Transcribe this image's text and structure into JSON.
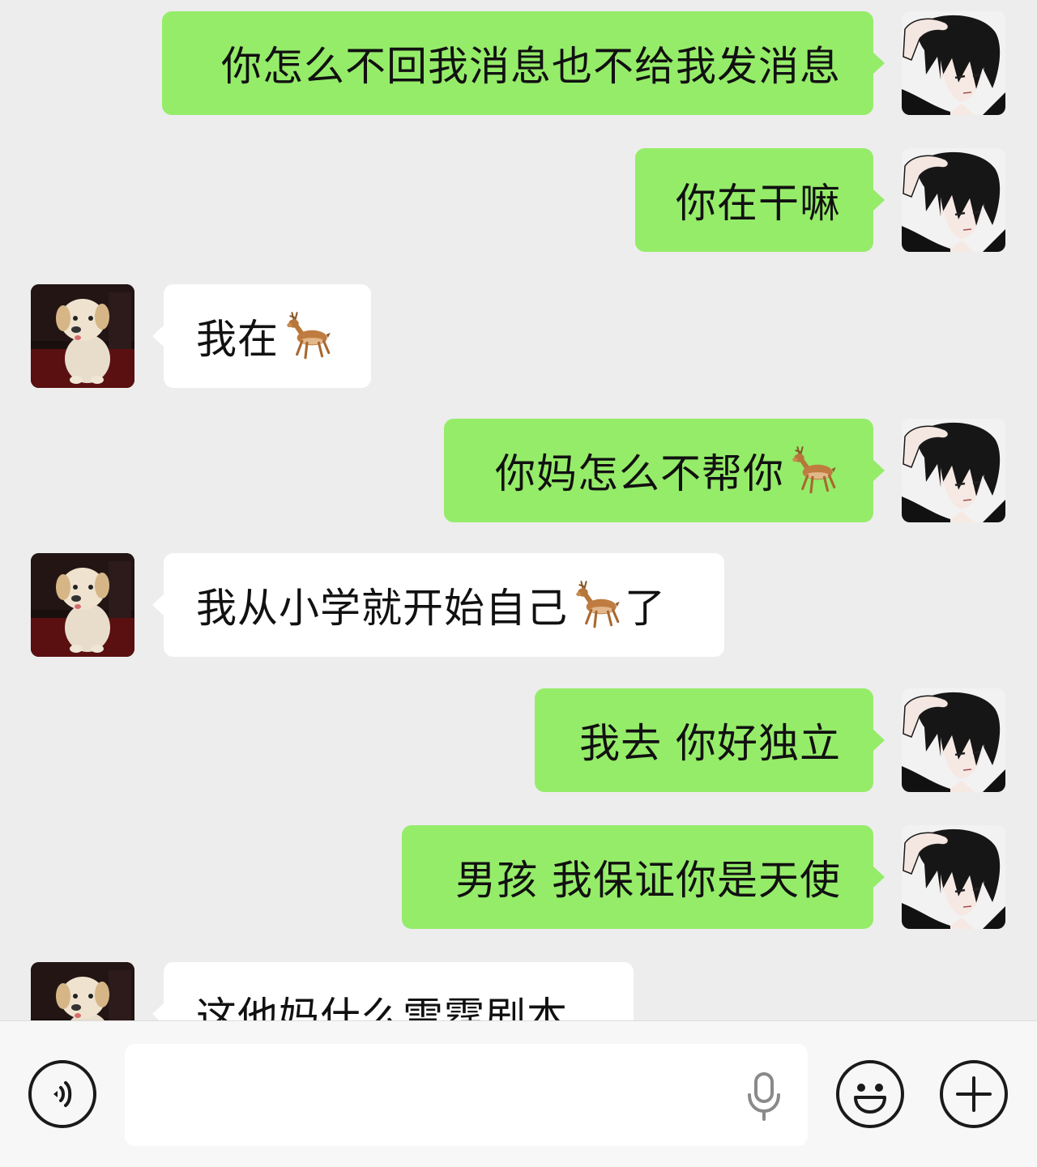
{
  "messages": [
    {
      "side": "out",
      "text": "你怎么不回我消息也不给我发消息",
      "avatar": "anime-boy-avatar"
    },
    {
      "side": "out",
      "text": "你在干嘛",
      "avatar": "anime-boy-avatar"
    },
    {
      "side": "in",
      "text_before": "我在",
      "emoji": "deer-emoji",
      "text_after": "",
      "avatar": "puppy-avatar"
    },
    {
      "side": "out",
      "text_before": "你妈怎么不帮你",
      "emoji": "deer-emoji",
      "text_after": "",
      "avatar": "anime-boy-avatar"
    },
    {
      "side": "in",
      "text_before": "我从小学就开始自己",
      "emoji": "deer-emoji",
      "text_after": "了",
      "avatar": "puppy-avatar"
    },
    {
      "side": "out",
      "text": "我去 你好独立",
      "avatar": "anime-boy-avatar"
    },
    {
      "side": "out",
      "text": "男孩 我保证你是天使",
      "avatar": "anime-boy-avatar"
    },
    {
      "side": "in",
      "text": "这他妈什么雷霆剧本",
      "avatar": "puppy-avatar"
    }
  ],
  "input_bar": {
    "voice_icon": "voice-wave-icon",
    "mic_icon": "microphone-icon",
    "emoji_icon": "smiley-face-icon",
    "plus_icon": "plus-icon",
    "input_value": ""
  },
  "colors": {
    "background": "#ededed",
    "outgoing_bubble": "#95ec69",
    "incoming_bubble": "#ffffff",
    "input_bar": "#f7f7f7"
  }
}
